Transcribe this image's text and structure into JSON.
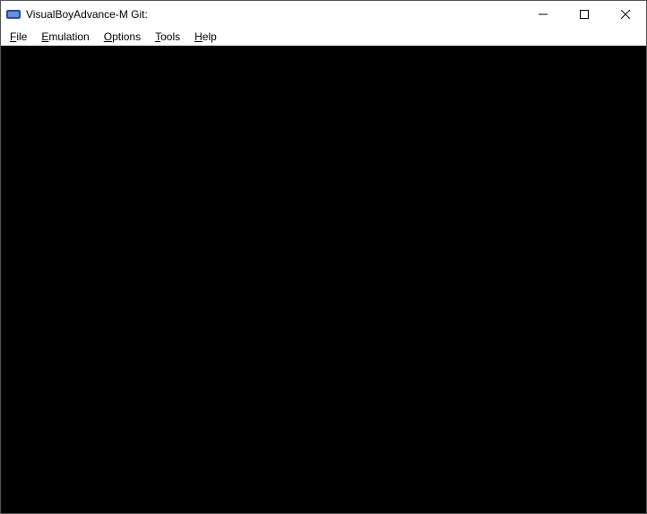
{
  "window": {
    "title": "VisualBoyAdvance-M Git:"
  },
  "menu": {
    "file": "File",
    "emulation": "Emulation",
    "options": "Options",
    "tools": "Tools",
    "help": "Help"
  }
}
